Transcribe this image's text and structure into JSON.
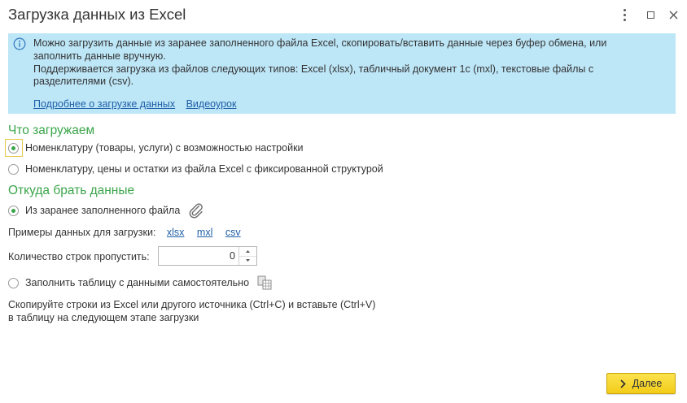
{
  "window": {
    "title": "Загрузка данных из Excel",
    "icons": [
      "kebab-menu-icon",
      "maximize-icon",
      "close-icon"
    ]
  },
  "info": {
    "icon": "info-icon",
    "lines": [
      "Можно загрузить данные из заранее заполненного файла Excel, скопировать/вставить данные через буфер обмена, или",
      "заполнить данные вручную.",
      "Поддерживается загрузка из файлов следующих типов: Excel (xlsx), табличный документ 1с (mxl), текстовые файлы с",
      "разделителями (csv)."
    ],
    "links": [
      "Подробнее о загрузке данных",
      "Видеоурок"
    ]
  },
  "what_section": {
    "title": "Что загружаем",
    "options": [
      {
        "label": "Номенклатуру (товары, услуги) с возможностью настройки",
        "selected": true
      },
      {
        "label": "Номенклатуру, цены и остатки из файла Excel с фиксированной структурой",
        "selected": false
      }
    ]
  },
  "source_section": {
    "title": "Откуда брать данные",
    "file_option": {
      "label": "Из заранее заполненного файла",
      "selected": true,
      "icon": "paperclip-icon"
    },
    "examples_label": "Примеры данных для загрузки:",
    "example_links": [
      "xlsx",
      "mxl",
      "csv"
    ],
    "skip_rows_label": "Количество строк пропустить:",
    "skip_rows_value": "0",
    "manual_option": {
      "label": "Заполнить таблицу с данными самостоятельно",
      "selected": false,
      "icon": "paste-table-icon"
    },
    "hint_lines": [
      "Скопируйте строки из Excel или другого источника (Ctrl+C) и вставьте (Ctrl+V)",
      "в таблицу на следующем этапе загрузки"
    ]
  },
  "footer": {
    "next_label": "Далее",
    "next_icon": "chevron-right-icon"
  },
  "colors": {
    "accent_green": "#3aa54a",
    "info_bg": "#bde6f7",
    "link": "#1f5fa8",
    "button_yellow": "#f3cc18"
  }
}
